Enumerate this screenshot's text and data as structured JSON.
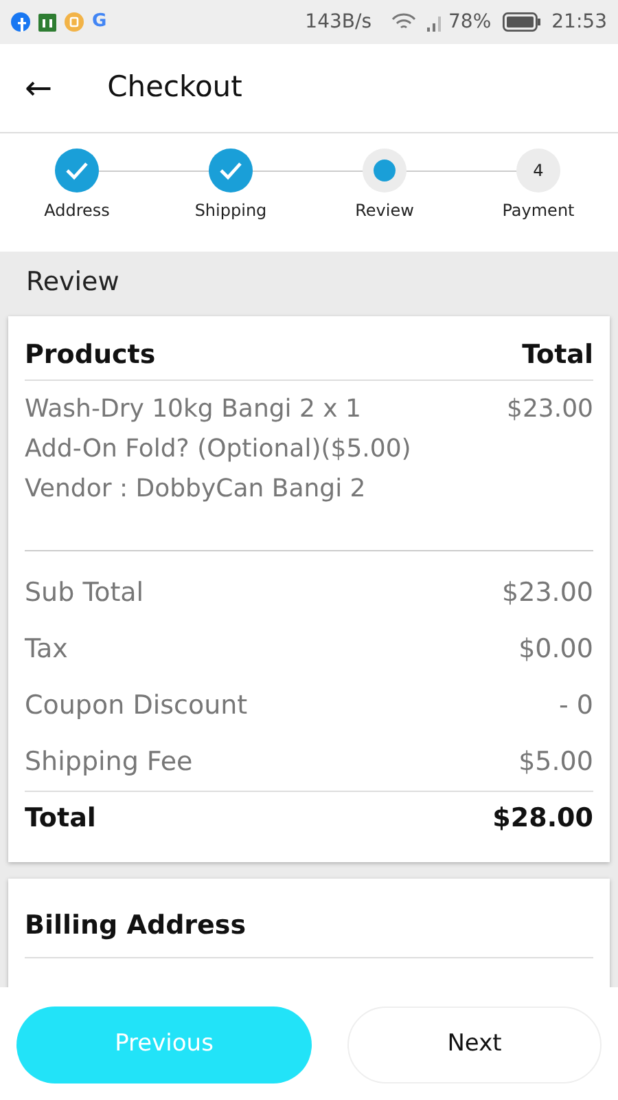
{
  "status_bar": {
    "notification_letter": "G",
    "speed": "143B/s",
    "battery": "78%",
    "time": "21:53"
  },
  "header": {
    "back": "←",
    "title": "Checkout"
  },
  "steps": [
    {
      "label": "Address",
      "completed": true,
      "selected": false
    },
    {
      "label": "Shipping",
      "completed": true,
      "selected": false
    },
    {
      "label": "Review",
      "completed": false,
      "selected": true
    },
    {
      "label": "Payment",
      "completed": false,
      "selected": false,
      "number": "4"
    }
  ],
  "section_title": "Review",
  "order": {
    "columns": [
      "Products",
      "Total"
    ],
    "products": [
      {
        "lines": [
          "Wash-Dry 10kg Bangi 2 x 1",
          "Add-On Fold? (Optional)($5.00)",
          "Vendor : DobbyCan Bangi 2"
        ],
        "price": "$23.00"
      }
    ],
    "summary": [
      {
        "kind": "line",
        "label": "Sub Total",
        "value": "$23.00"
      },
      {
        "kind": "line",
        "label": "Tax",
        "value": "$0.00"
      },
      {
        "kind": "line",
        "label": "Coupon Discount",
        "value": "- 0"
      },
      {
        "kind": "line",
        "label": "Shipping Fee",
        "value": "$5.00"
      },
      {
        "kind": "total",
        "label": "Total",
        "value": "$28.00"
      }
    ]
  },
  "billing": {
    "title": "Billing Address"
  },
  "buttons": [
    {
      "label": "Previous",
      "kind": "primary"
    },
    {
      "label": "Next",
      "kind": "outline"
    }
  ]
}
